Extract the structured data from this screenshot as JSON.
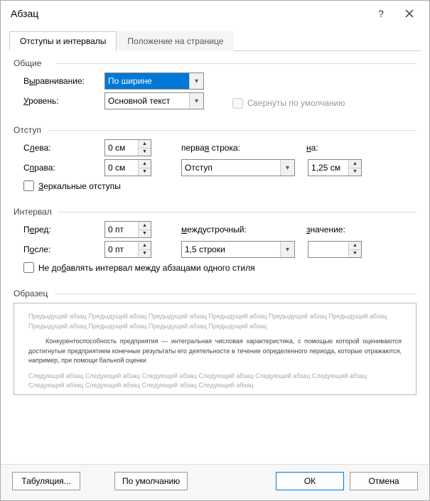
{
  "title": "Абзац",
  "tabs": {
    "t0": "Отступы и интервалы",
    "t1": "Положение на странице"
  },
  "groups": {
    "general": "Общие",
    "indent": "Отступ",
    "spacing": "Интервал",
    "sample": "Образец"
  },
  "labels": {
    "alignment": "Выравнивание:",
    "level": "Уровень:",
    "collapsed": "Свернуты по умолчанию",
    "left": "Слева:",
    "right": "Справа:",
    "firstline": "первая строка:",
    "firstline_on": "на:",
    "mirror": "Зеркальные отступы",
    "before": "Перед:",
    "after": "После:",
    "linespacing": "междустрочный:",
    "lineval": "значение:",
    "nospace": "Не добавлять интервал между абзацами одного стиля"
  },
  "values": {
    "alignment": "По ширине",
    "level": "Основной текст",
    "left": "0 см",
    "right": "0 см",
    "firstline_type": "Отступ",
    "firstline_val": "1,25 см",
    "before": "0 пт",
    "after": "0 пт",
    "linespacing": "1,5 строки",
    "lineval": ""
  },
  "preview": {
    "prev": "Предыдущий абзац Предыдущий абзац Предыдущий абзац Предыдущий абзац Предыдущий абзац Предыдущий абзац Предыдущий абзац Предыдущий абзац Предыдущий абзац Предыдущий абзац",
    "body": "Конкурентоспособность предприятия — интегральная числовая характеристика, с помощью которой оцениваются достигнутые предприятием конечные результаты его деятельности в течение определенного периода, которые отражаются, например, при помощи бальной оценки",
    "next": "Следующий абзац Следующий абзац Следующий абзац Следующий абзац Следующий абзац Следующий абзац Следующий абзац Следующий абзац Следующий абзац Следующий абзац"
  },
  "buttons": {
    "tabs": "Табуляция...",
    "default": "По умолчанию",
    "ok": "ОК",
    "cancel": "Отмена"
  }
}
